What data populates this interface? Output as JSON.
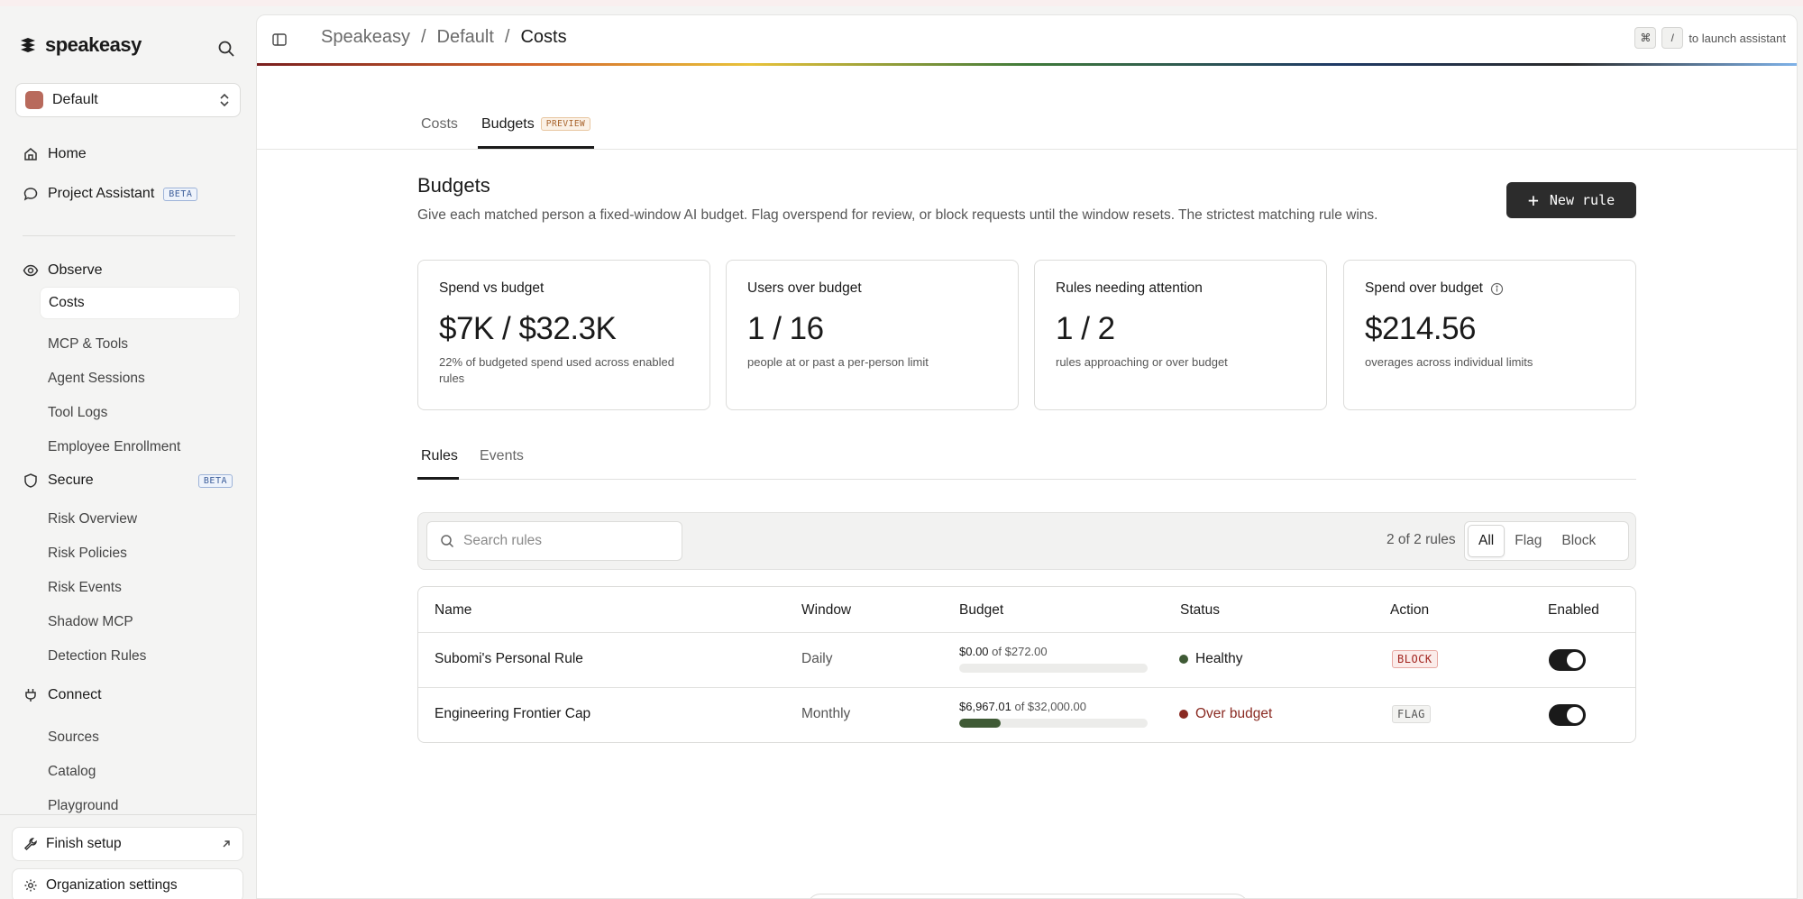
{
  "brand": {
    "name": "speakeasy"
  },
  "project": {
    "name": "Default",
    "color": "#b86a5c"
  },
  "nav": {
    "home": "Home",
    "assistant": "Project Assistant",
    "assistant_badge": "BETA",
    "observe": "Observe",
    "observe_items": [
      "Costs",
      "MCP & Tools",
      "Agent Sessions",
      "Tool Logs",
      "Employee Enrollment"
    ],
    "secure": "Secure",
    "secure_badge": "BETA",
    "secure_items": [
      "Risk Overview",
      "Risk Policies",
      "Risk Events",
      "Shadow MCP",
      "Detection Rules"
    ],
    "connect": "Connect",
    "connect_items": [
      "Sources",
      "Catalog",
      "Playground"
    ],
    "finish_setup": "Finish setup",
    "org_settings": "Organization settings"
  },
  "header": {
    "crumbs": [
      "Speakeasy",
      "/",
      "Default",
      "/",
      "Costs"
    ],
    "kbd1": "⌘",
    "kbd2": "/",
    "hint": "to launch assistant"
  },
  "tabs": {
    "costs": "Costs",
    "budgets": "Budgets",
    "preview_badge": "PREVIEW"
  },
  "page": {
    "title": "Budgets",
    "description": "Give each matched person a fixed-window AI budget. Flag overspend for review, or block requests until the window resets. The strictest matching rule wins.",
    "new_rule": "New rule"
  },
  "stats": [
    {
      "label": "Spend vs budget",
      "value": "$7K / $32.3K",
      "sub": "22% of budgeted spend used across enabled rules"
    },
    {
      "label": "Users over budget",
      "value": "1 / 16",
      "sub": "people at or past a per-person limit"
    },
    {
      "label": "Rules needing attention",
      "value": "1 / 2",
      "sub": "rules approaching or over budget"
    },
    {
      "label": "Spend over budget",
      "value": "$214.56",
      "sub": "overages across individual limits"
    }
  ],
  "subtabs": {
    "rules": "Rules",
    "events": "Events"
  },
  "filter": {
    "search_placeholder": "Search rules",
    "count": "2 of 2 rules",
    "segments": [
      "All",
      "Flag",
      "Block"
    ],
    "selected": "All"
  },
  "table": {
    "headers": [
      "Name",
      "Window",
      "Budget",
      "Status",
      "Action",
      "Enabled"
    ],
    "rows": [
      {
        "name": "Subomi's Personal Rule",
        "window": "Daily",
        "spent": "$0.00",
        "of": "of $272.00",
        "progress": 0.0,
        "status": "Healthy",
        "status_color": "#3f5a35",
        "action": "BLOCK",
        "enabled": true
      },
      {
        "name": "Engineering Frontier Cap",
        "window": "Monthly",
        "spent": "$6,967.01",
        "of": "of $32,000.00",
        "progress": 0.218,
        "status": "Over budget",
        "status_color": "#8a2a22",
        "action": "FLAG",
        "enabled": true
      }
    ]
  }
}
